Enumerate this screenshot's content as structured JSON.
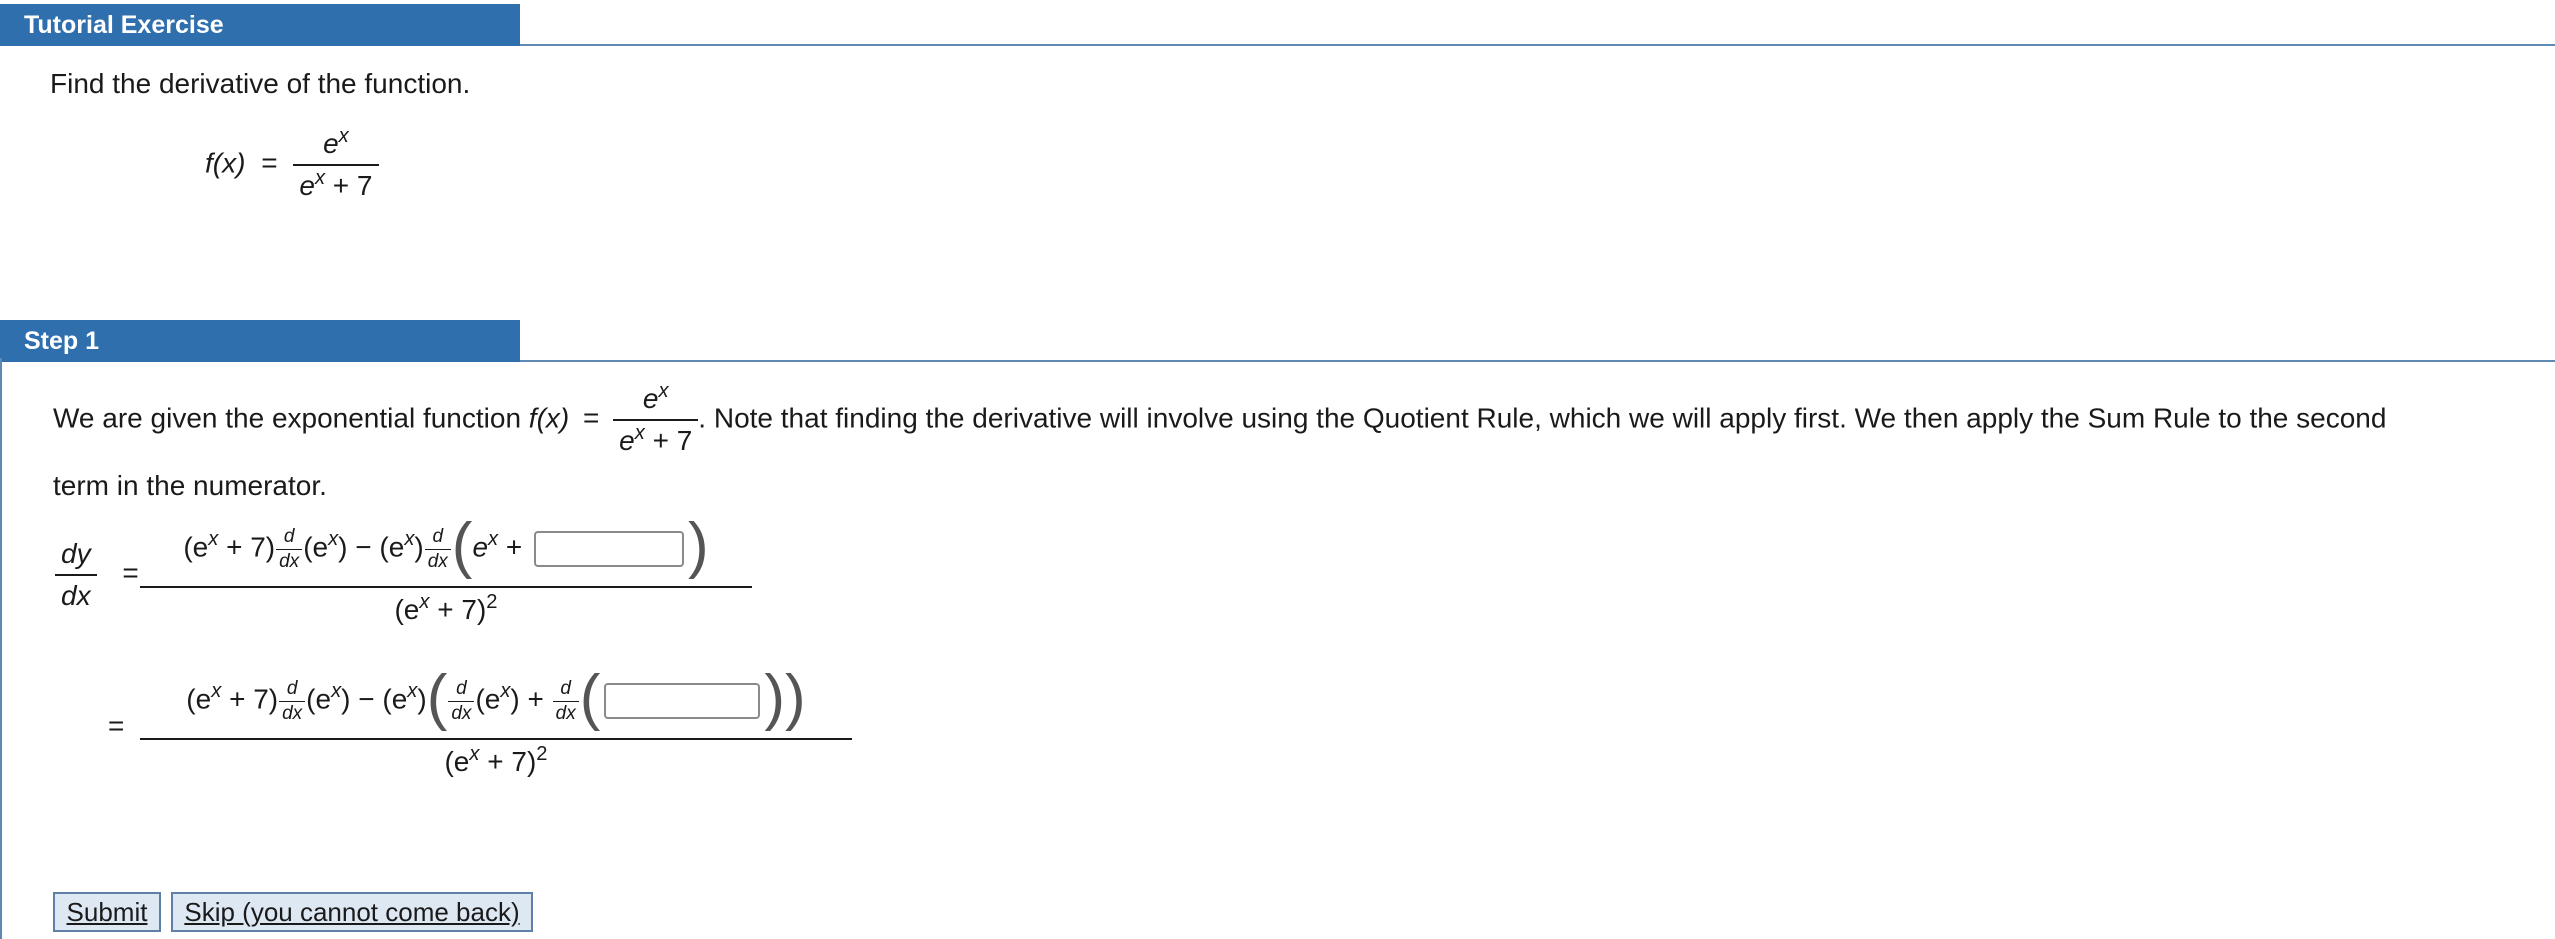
{
  "tutorial": {
    "header": "Tutorial Exercise",
    "instruction": "Find the derivative of the function.",
    "function": {
      "lhs": "f(x)",
      "eq": "=",
      "numerator": "e",
      "numerator_exp": "x",
      "denominator_base": "e",
      "denominator_exp": "x",
      "denominator_rest": "+ 7"
    }
  },
  "step1": {
    "header": "Step 1",
    "text_before": "We are given the exponential function",
    "fx": "f(x)",
    "eq": "=",
    "frac_num": "e",
    "frac_num_exp": "x",
    "frac_den_base": "e",
    "frac_den_exp": "x",
    "frac_den_rest": "+ 7",
    "text_after": ". Note that finding the derivative will involve using the Quotient Rule, which we will apply first. We then apply the Sum Rule to the second",
    "text_line2": "term in the numerator.",
    "dy": "dy",
    "dx": "dx",
    "d": "d",
    "eq_sign": "=",
    "expr1": {
      "part_a": "(e",
      "exp": "x",
      "part_b": "+ 7)",
      "part_c": "(e",
      "part_d": ") − (e",
      "part_e": ")",
      "part_f": "e",
      "part_g": "+",
      "den": "(e",
      "den_rest": "+ 7)",
      "den_exp": "2"
    },
    "expr2": {
      "part_a": "(e",
      "part_b": "+ 7)",
      "part_c": "(e",
      "part_d": ") − (e",
      "part_e": ")",
      "part_f": "(e",
      "part_g": ") +",
      "den": "(e",
      "den_rest": "+ 7)",
      "den_exp": "2"
    },
    "answer1_value": "",
    "answer2_value": ""
  },
  "buttons": {
    "submit": "Submit",
    "skip": "Skip (you cannot come back)"
  }
}
